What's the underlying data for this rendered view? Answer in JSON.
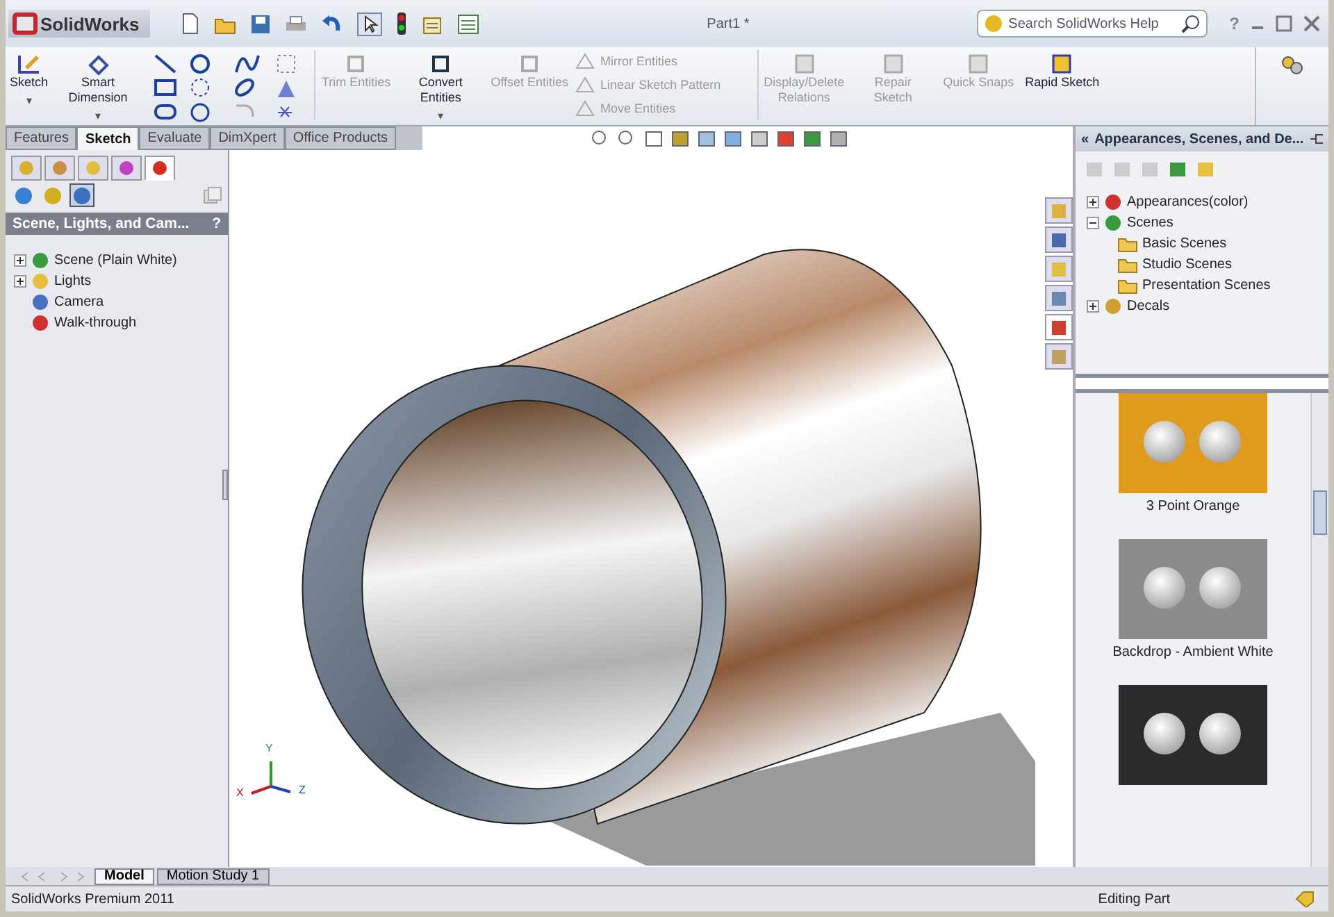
{
  "app_name": "SolidWorks",
  "window": {
    "title": "Part1 *"
  },
  "search": {
    "placeholder": "Search SolidWorks Help"
  },
  "help_menu": "?",
  "command_manager": {
    "large_buttons": [
      {
        "label": "Sketch",
        "disabled": false,
        "caret": "▾"
      },
      {
        "label": "Smart Dimension",
        "disabled": false,
        "caret": "▾"
      }
    ],
    "entity_buttons": [
      {
        "label": "Trim Entities",
        "disabled": true
      },
      {
        "label": "Convert Entities",
        "disabled": false,
        "caret": "▾"
      },
      {
        "label": "Offset Entities",
        "disabled": true
      }
    ],
    "small_commands": [
      {
        "label": "Mirror Entities",
        "disabled": true
      },
      {
        "label": "Linear Sketch Pattern",
        "disabled": true
      },
      {
        "label": "Move Entities",
        "disabled": true
      }
    ],
    "right_buttons": [
      {
        "label": "Display/Delete Relations",
        "disabled": true
      },
      {
        "label": "Repair Sketch",
        "disabled": true
      },
      {
        "label": "Quick Snaps",
        "disabled": true
      },
      {
        "label": "Rapid Sketch",
        "disabled": false
      }
    ]
  },
  "tabs": [
    {
      "label": "Features",
      "selected": false
    },
    {
      "label": "Sketch",
      "selected": true
    },
    {
      "label": "Evaluate",
      "selected": false
    },
    {
      "label": "DimXpert",
      "selected": false
    },
    {
      "label": "Office Products",
      "selected": false
    }
  ],
  "left_panel": {
    "icon_tabs": [
      {
        "selected": false
      },
      {
        "selected": false
      },
      {
        "selected": false
      },
      {
        "selected": false
      },
      {
        "selected": true
      }
    ],
    "sub_tabs": [
      {
        "selected": false
      },
      {
        "selected": false
      },
      {
        "selected": true
      }
    ],
    "title": "Scene, Lights, and Cam...",
    "help": "?",
    "tree": [
      {
        "label": "Scene (Plain White)",
        "kind": "branch",
        "expanded": false
      },
      {
        "label": "Lights",
        "kind": "branch",
        "expanded": false
      },
      {
        "label": "Camera",
        "kind": "leaf"
      },
      {
        "label": "Walk-through",
        "kind": "leaf"
      }
    ]
  },
  "viewport": {
    "triad": {
      "x": "X",
      "y": "Y",
      "z": "Z"
    }
  },
  "task_tabs": [
    {
      "selected": false
    },
    {
      "selected": false
    },
    {
      "selected": false
    },
    {
      "selected": false
    },
    {
      "selected": true
    },
    {
      "selected": false
    }
  ],
  "task_pane": {
    "collapse": "«",
    "title": "Appearances, Scenes, and De...",
    "tree": [
      {
        "label": "Appearances(color)",
        "expanded": false
      },
      {
        "label": "Scenes",
        "expanded": true,
        "children": [
          {
            "label": "Basic Scenes"
          },
          {
            "label": "Studio Scenes"
          },
          {
            "label": "Presentation Scenes"
          }
        ]
      },
      {
        "label": "Decals",
        "expanded": false
      }
    ],
    "thumbnails": [
      {
        "label": "3 Point Orange",
        "color": "#e09a1c"
      },
      {
        "label": "Backdrop - Ambient White",
        "color": "#8c8c8c"
      },
      {
        "color": "#2a2a2a"
      }
    ]
  },
  "bottom_tabs": [
    {
      "label": "Model",
      "selected": true
    },
    {
      "label": "Motion Study 1",
      "selected": false
    }
  ],
  "status_bar": {
    "left": "SolidWorks Premium 2011",
    "right": "Editing Part"
  }
}
